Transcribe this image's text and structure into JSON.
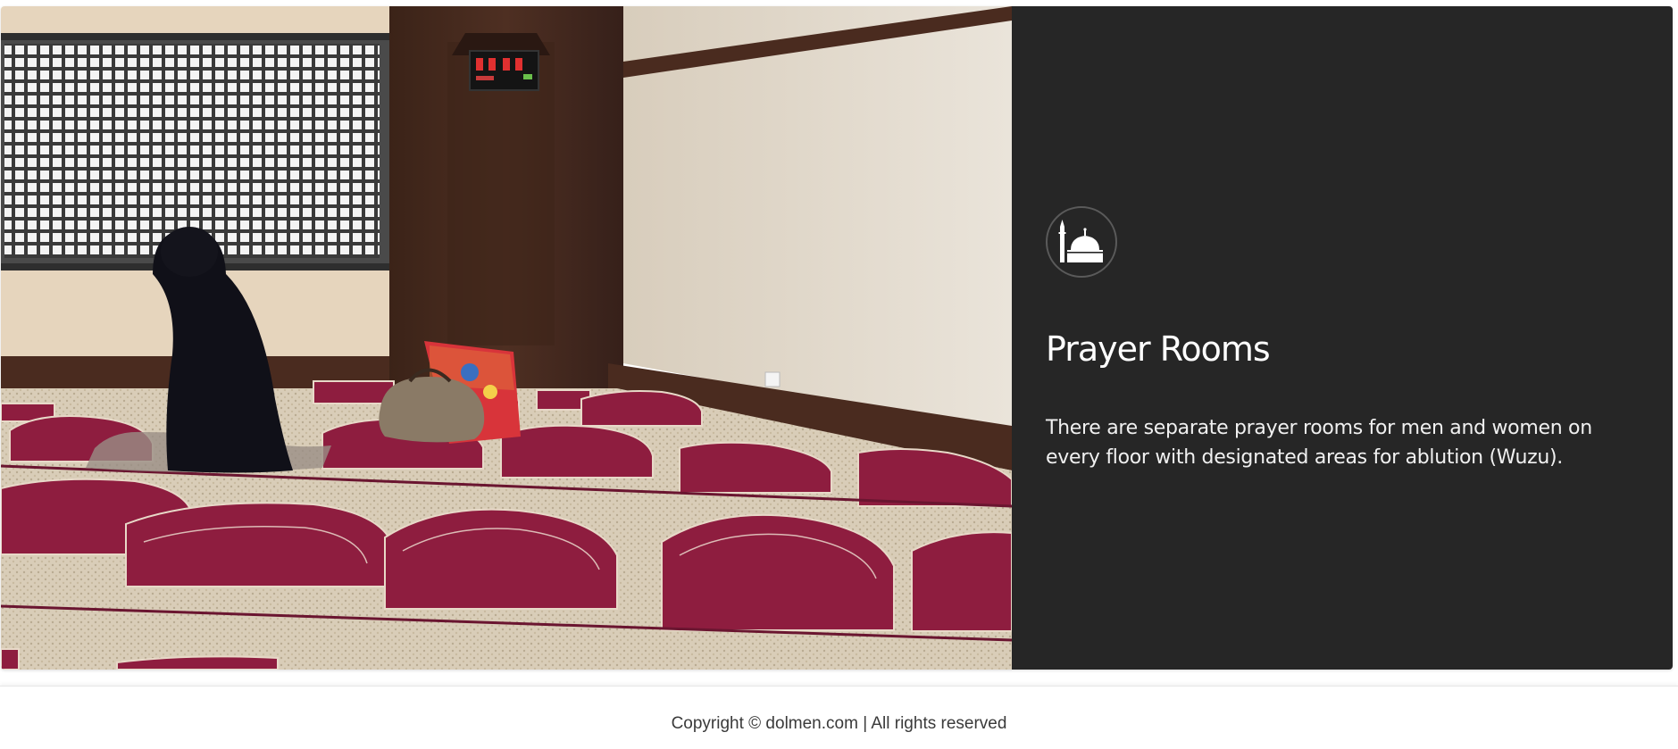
{
  "feature": {
    "icon": "mosque-icon",
    "title": "Prayer Rooms",
    "description": "There are separate prayer rooms for men and women on every floor with designated areas for ablution (Wuzu).",
    "image_alt": "Woman praying in a prayer room with red prayer carpets"
  },
  "footer": {
    "copyright": "Copyright © dolmen.com | All rights reserved"
  },
  "colors": {
    "panel_bg": "#262626",
    "carpet_red": "#8e1d3f",
    "text_light": "#ffffff"
  }
}
